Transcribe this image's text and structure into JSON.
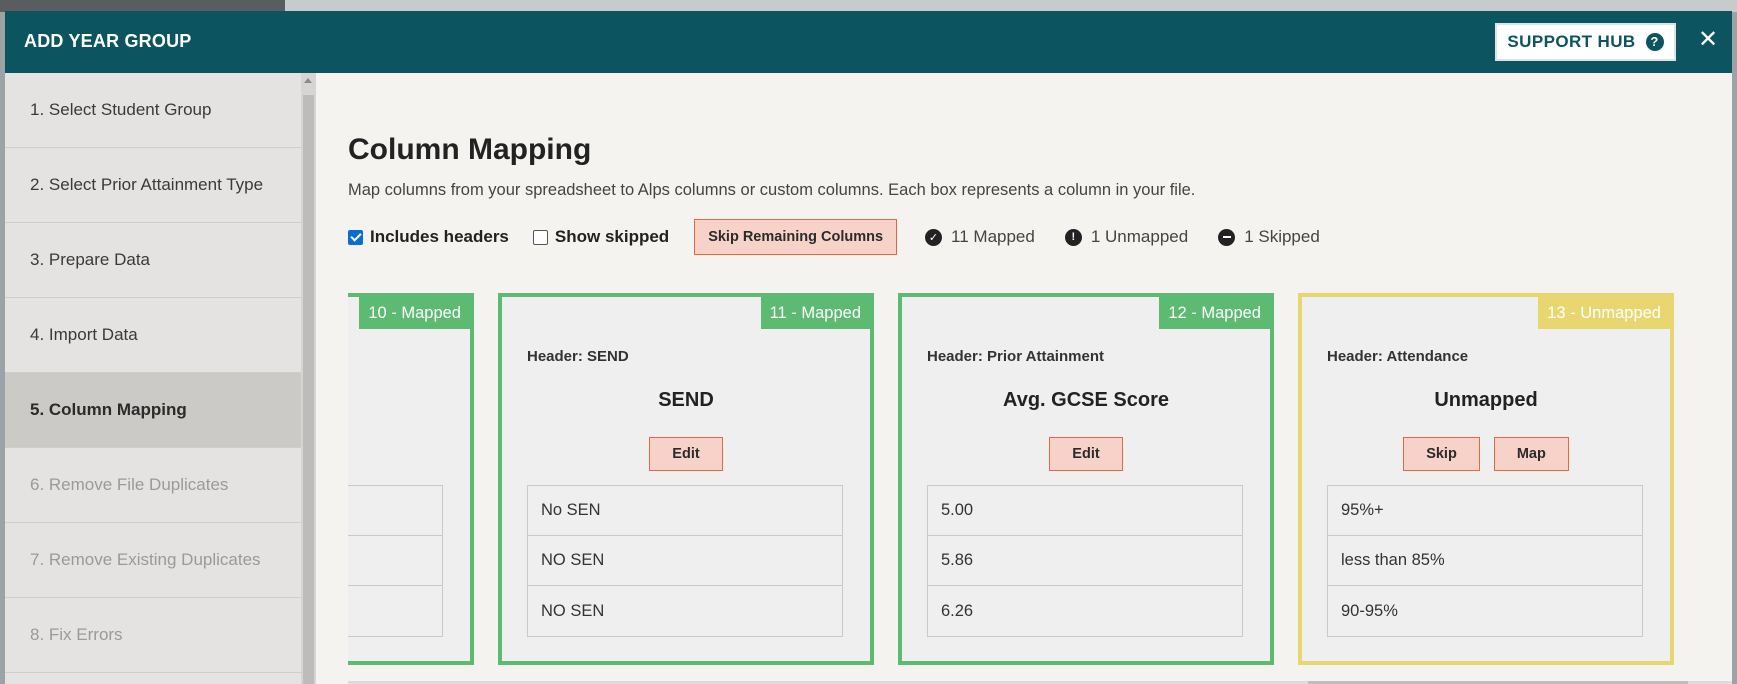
{
  "modal": {
    "title": "ADD YEAR GROUP",
    "support_label": "SUPPORT HUB",
    "support_icon": "question-circle-icon",
    "close_label": "✕"
  },
  "sidebar": {
    "steps": [
      {
        "label": "1. Select Student Group",
        "state": "done"
      },
      {
        "label": "2. Select Prior Attainment Type",
        "state": "done"
      },
      {
        "label": "3. Prepare Data",
        "state": "done"
      },
      {
        "label": "4. Import Data",
        "state": "done"
      },
      {
        "label": "5. Column Mapping",
        "state": "active"
      },
      {
        "label": "6. Remove File Duplicates",
        "state": "disabled"
      },
      {
        "label": "7. Remove Existing Duplicates",
        "state": "disabled"
      },
      {
        "label": "8. Fix Errors",
        "state": "disabled"
      }
    ]
  },
  "main": {
    "title": "Column Mapping",
    "description": "Map columns from your spreadsheet to Alps columns or custom columns. Each box represents a column in your file.",
    "includes_headers": {
      "label": "Includes headers",
      "checked": true
    },
    "show_skipped": {
      "label": "Show skipped",
      "checked": false
    },
    "skip_remaining_label": "Skip Remaining Columns",
    "stats": {
      "mapped": "11 Mapped",
      "unmapped": "1 Unmapped",
      "skipped": "1 Skipped"
    },
    "cards": [
      {
        "badge": "10 - Mapped",
        "status": "mapped",
        "header": "",
        "name": "",
        "buttons": [],
        "samples": [
          "",
          "",
          ""
        ]
      },
      {
        "badge": "11 - Mapped",
        "status": "mapped",
        "header": "Header: SEND",
        "name": "SEND",
        "buttons": [
          "Edit"
        ],
        "samples": [
          "No SEN",
          "NO SEN",
          "NO SEN"
        ]
      },
      {
        "badge": "12 - Mapped",
        "status": "mapped",
        "header": "Header: Prior Attainment",
        "name": "Avg. GCSE Score",
        "buttons": [
          "Edit"
        ],
        "samples": [
          "5.00",
          "5.86",
          "6.26"
        ]
      },
      {
        "badge": "13 - Unmapped",
        "status": "unmapped",
        "header": "Header: Attendance",
        "name": "Unmapped",
        "buttons": [
          "Skip",
          "Map"
        ],
        "samples": [
          "95%+",
          "less than 85%",
          "90-95%"
        ]
      }
    ]
  },
  "colors": {
    "header_bg": "#0b5460",
    "mapped": "#5cba73",
    "unmapped": "#e8d671",
    "button_bg": "#f6d2c8",
    "button_border": "#e0693f"
  }
}
